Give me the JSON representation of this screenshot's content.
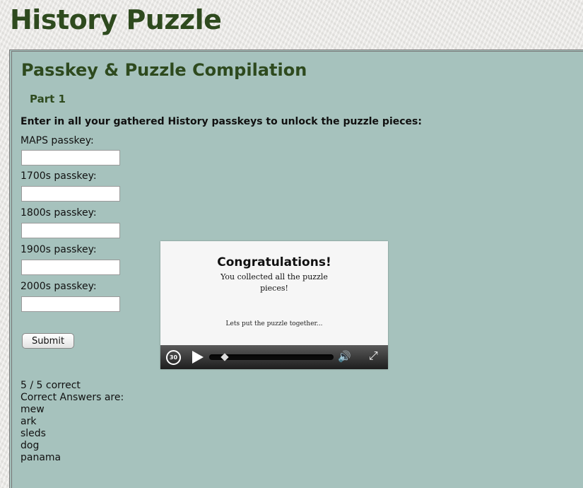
{
  "page": {
    "site_title": "History Puzzle"
  },
  "panel": {
    "title": "Passkey & Puzzle Compilation",
    "part": "Part 1",
    "instructions": "Enter in all your gathered History passkeys to unlock the puzzle pieces:"
  },
  "fields": [
    {
      "label": "MAPS passkey:",
      "value": ""
    },
    {
      "label": "1700s passkey:",
      "value": ""
    },
    {
      "label": "1800s passkey:",
      "value": ""
    },
    {
      "label": "1900s passkey:",
      "value": ""
    },
    {
      "label": "2000s passkey:",
      "value": ""
    }
  ],
  "submit_label": "Submit",
  "results": {
    "score": "5 / 5 correct",
    "answers_heading": "Correct Answers are:",
    "answers": [
      "mew",
      "ark",
      "sleds",
      "dog",
      "panama"
    ]
  },
  "video": {
    "heading": "Congratulations!",
    "body": "You collected all the puzzle pieces!",
    "note": "Lets put the puzzle together...",
    "replay_label": "30",
    "progress": 0.1,
    "icons": {
      "replay": "replay-30-icon",
      "play": "play-icon",
      "volume": "volume-icon",
      "fullscreen": "fullscreen-icon"
    }
  },
  "colors": {
    "title": "#2e4a1e",
    "panel_bg": "#a6c2bd"
  }
}
